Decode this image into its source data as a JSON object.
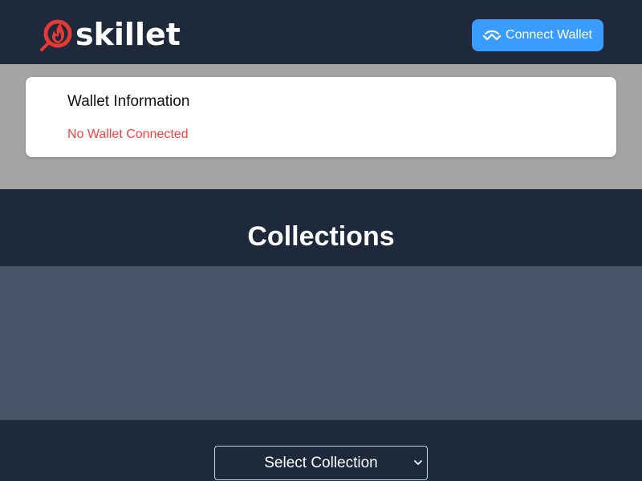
{
  "header": {
    "logo_text": "skillet",
    "logo_icon": "skillet-flame-icon",
    "connect_button": {
      "label": "Connect Wallet",
      "icon": "walletconnect-icon"
    }
  },
  "wallet": {
    "title": "Wallet Information",
    "status": "No Wallet Connected"
  },
  "collections": {
    "title": "Collections",
    "select": {
      "selected": "Select Collection"
    }
  },
  "colors": {
    "background": "#1e293b",
    "accent": "#3b9cff",
    "error": "#ef4444",
    "logo_red": "#e53935",
    "band_gray": "#a3a3a3",
    "panel_slate": "#475569"
  }
}
